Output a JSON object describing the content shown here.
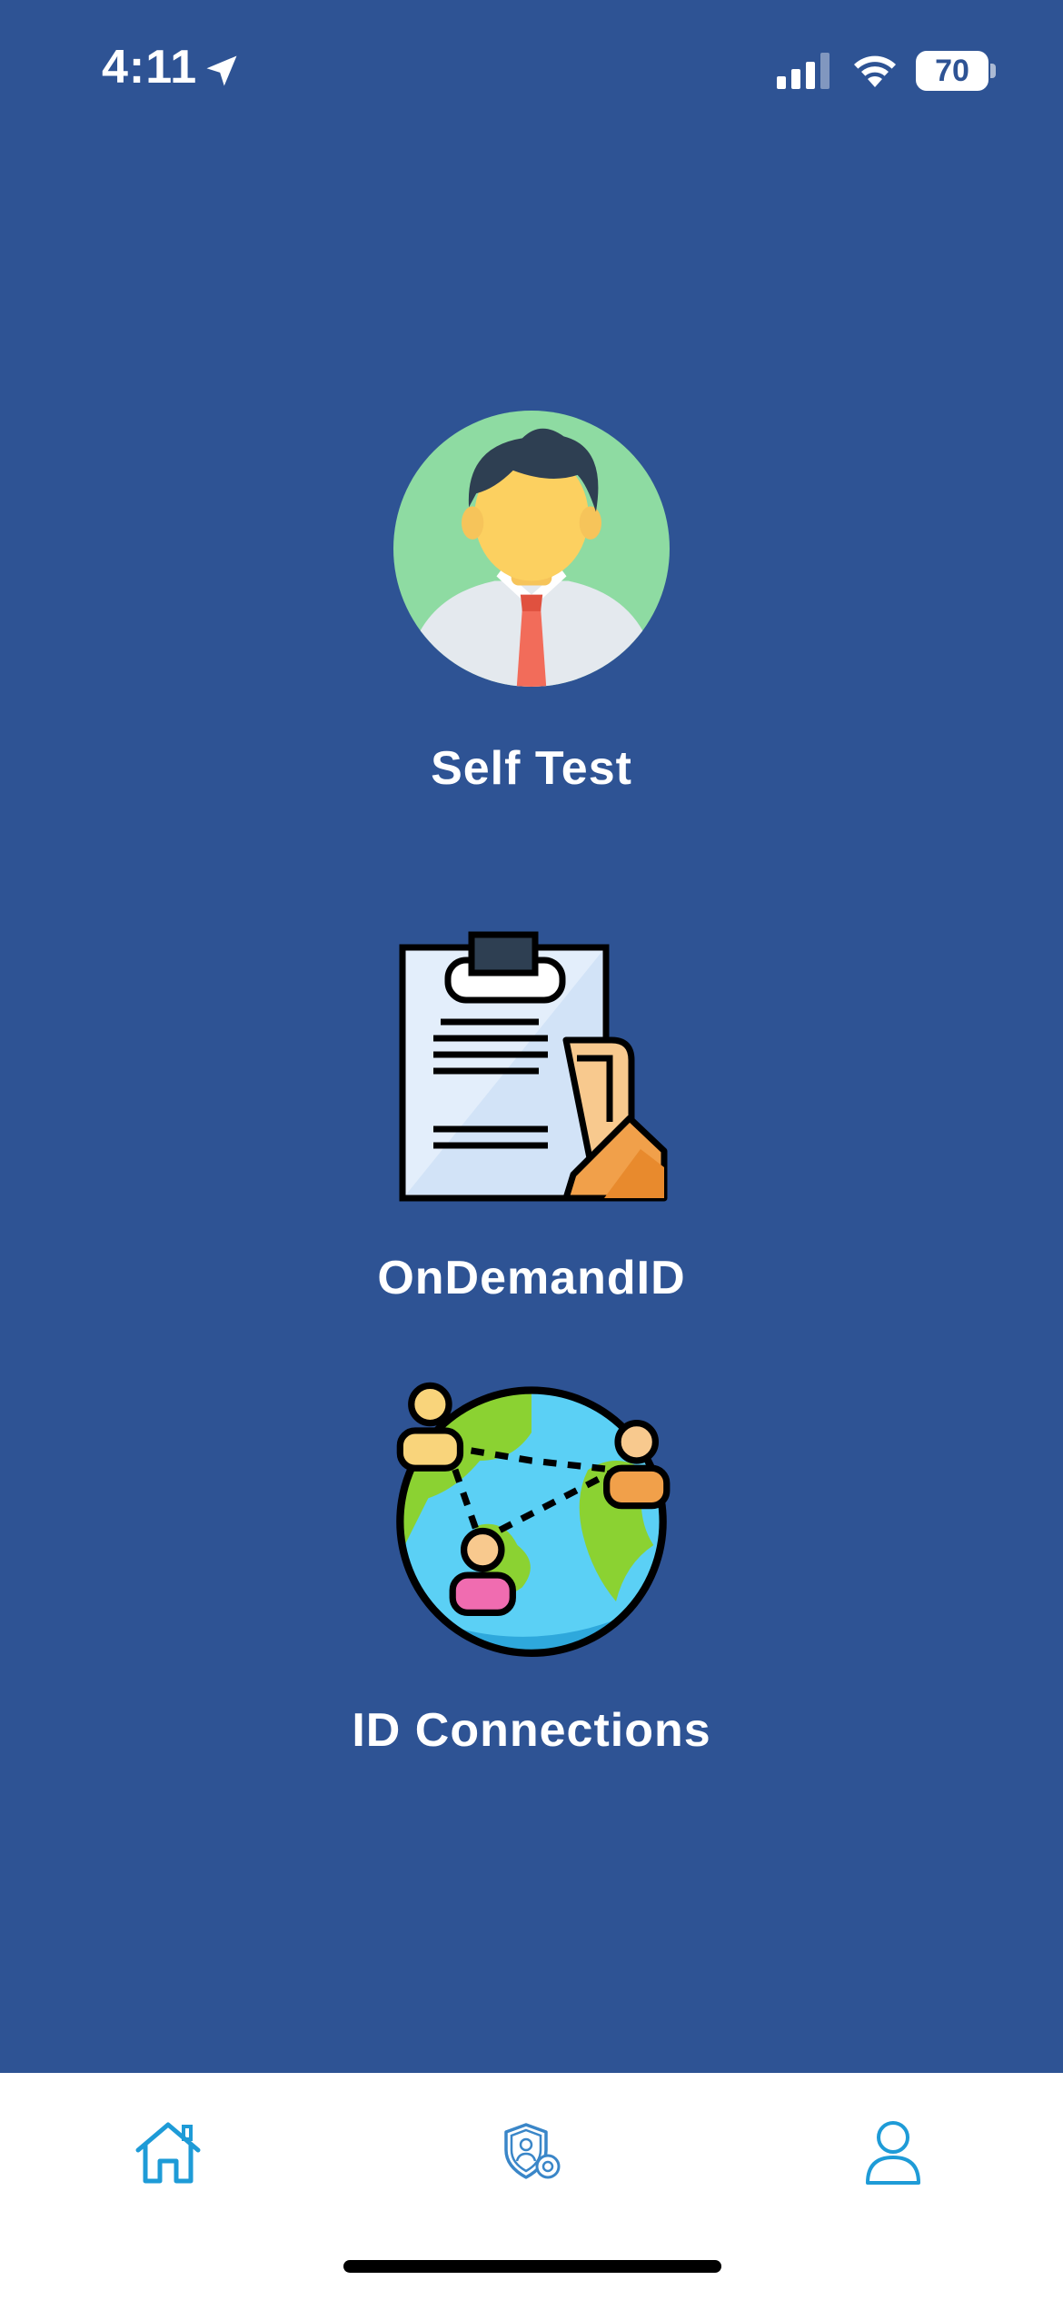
{
  "status_bar": {
    "time": "4:11",
    "battery": "70",
    "icons": [
      "location-arrow-icon",
      "cell-signal-icon",
      "wifi-icon",
      "battery-icon"
    ]
  },
  "menu": {
    "items": [
      {
        "label": "Self Test",
        "icon": "person-avatar-icon"
      },
      {
        "label": "OnDemandID",
        "icon": "clipboard-document-icon"
      },
      {
        "label": "ID Connections",
        "icon": "globe-people-icon"
      }
    ]
  },
  "tab_bar": {
    "tabs": [
      {
        "icon": "home-icon"
      },
      {
        "icon": "shield-gear-icon"
      },
      {
        "icon": "profile-icon"
      }
    ]
  },
  "colors": {
    "background": "#2E5394",
    "tab_bar": "#FFFFFF",
    "tab_icon": "#1E9BD7",
    "text": "#FFFFFF"
  }
}
